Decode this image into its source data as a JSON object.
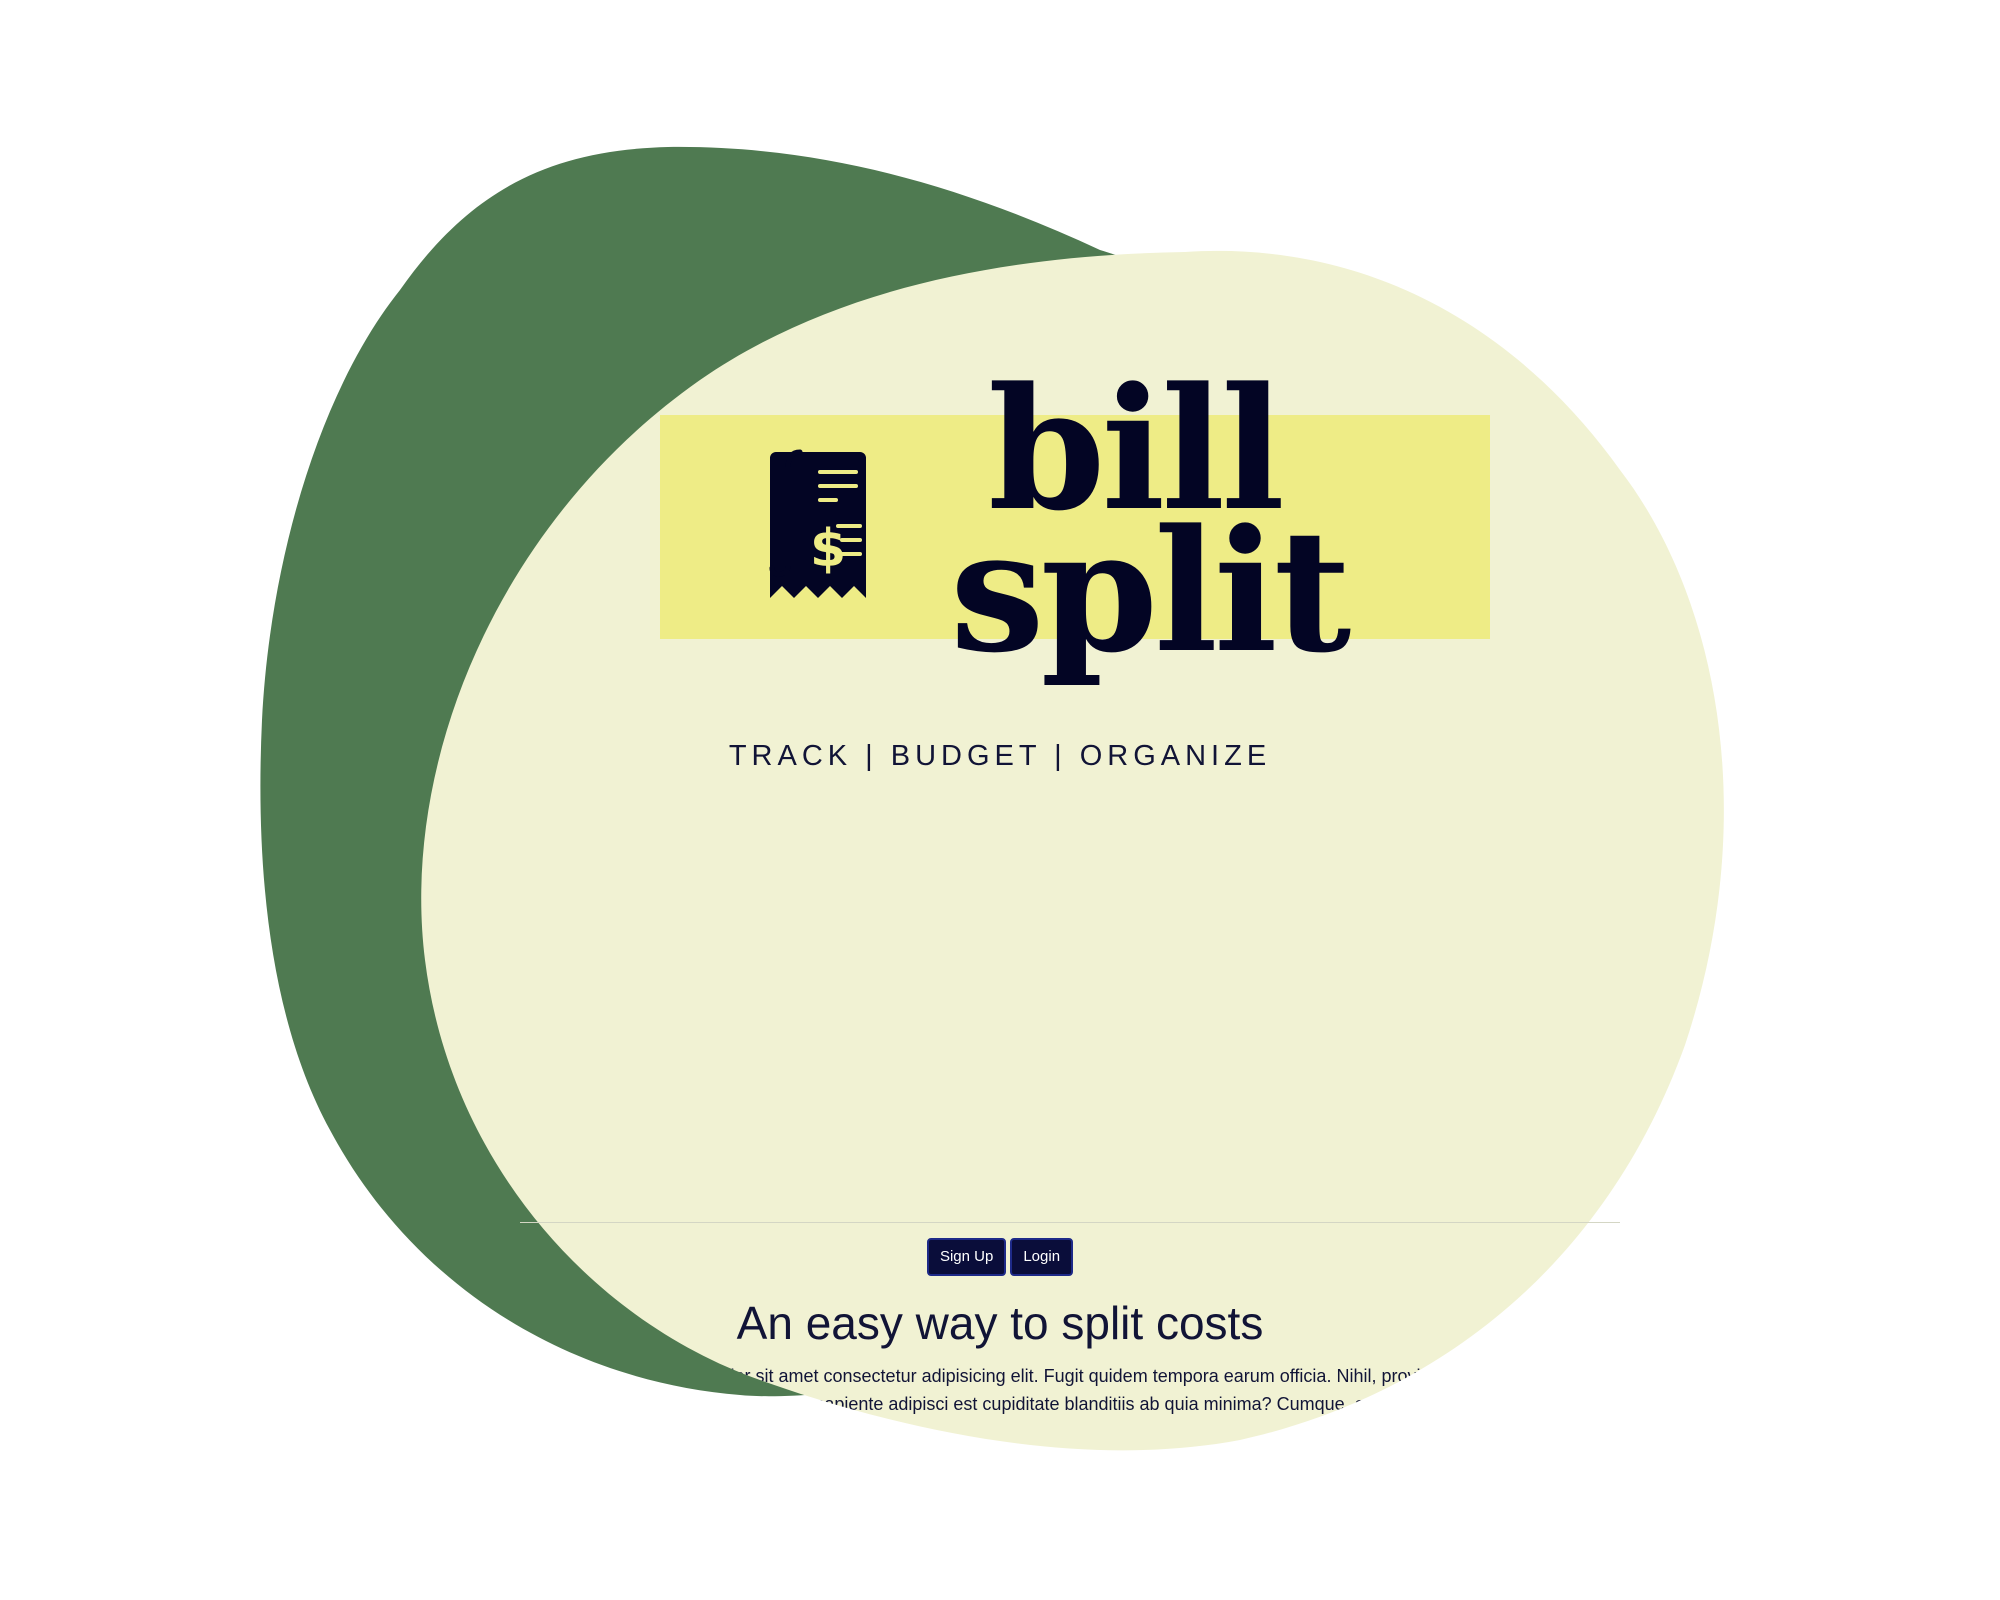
{
  "colors": {
    "background": "#ffffff",
    "green_blob": "#4f7a51",
    "cream_blob": "#f1f2d3",
    "logo_band": "#eeec86",
    "navy": "#030524",
    "receipt_accent": "#eeec86"
  },
  "logo": {
    "line1": "bill",
    "line2": "split",
    "icon": "receipt-dollar-icon"
  },
  "tagline": "TRACK | BUDGET | ORGANIZE",
  "nav": {
    "signup_label": "Sign Up",
    "login_label": "Login"
  },
  "hero": {
    "headline": "An easy way to split costs",
    "body": "Lorem ipsum dolor sit amet consectetur adipisicing elit. Fugit quidem tempora earum officia. Nihil, provident eveniet asperiores sapiente adipisci est cupiditate blanditiis ab quia minima? Cumque, odio."
  }
}
